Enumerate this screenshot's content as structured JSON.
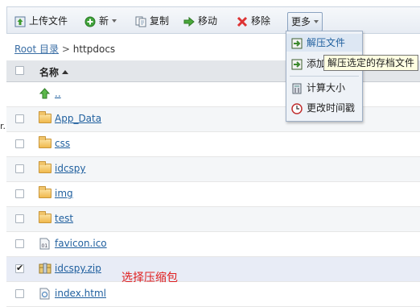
{
  "toolbar": {
    "upload": "上传文件",
    "new": "新",
    "copy": "复制",
    "move": "移动",
    "remove": "移除",
    "more": "更多"
  },
  "breadcrumb": {
    "root": "Root 目录",
    "separator": ">",
    "current": "httpdocs"
  },
  "table": {
    "header_name": "名称"
  },
  "files": [
    {
      "name": "..",
      "type": "up"
    },
    {
      "name": "App_Data",
      "type": "folder"
    },
    {
      "name": "css",
      "type": "folder"
    },
    {
      "name": "idcspy",
      "type": "folder"
    },
    {
      "name": "img",
      "type": "folder"
    },
    {
      "name": "test",
      "type": "folder"
    },
    {
      "name": "favicon.ico",
      "type": "file"
    },
    {
      "name": "idcspy.zip",
      "type": "zip",
      "checked": true
    },
    {
      "name": "index.html",
      "type": "file"
    }
  ],
  "annotation": "选择压缩包",
  "left_cut_text": "r.",
  "more_menu": {
    "items": [
      "解压文件",
      "添加",
      "计算大小",
      "更改时间戳"
    ]
  },
  "tooltip": "解压选定的存档文件"
}
